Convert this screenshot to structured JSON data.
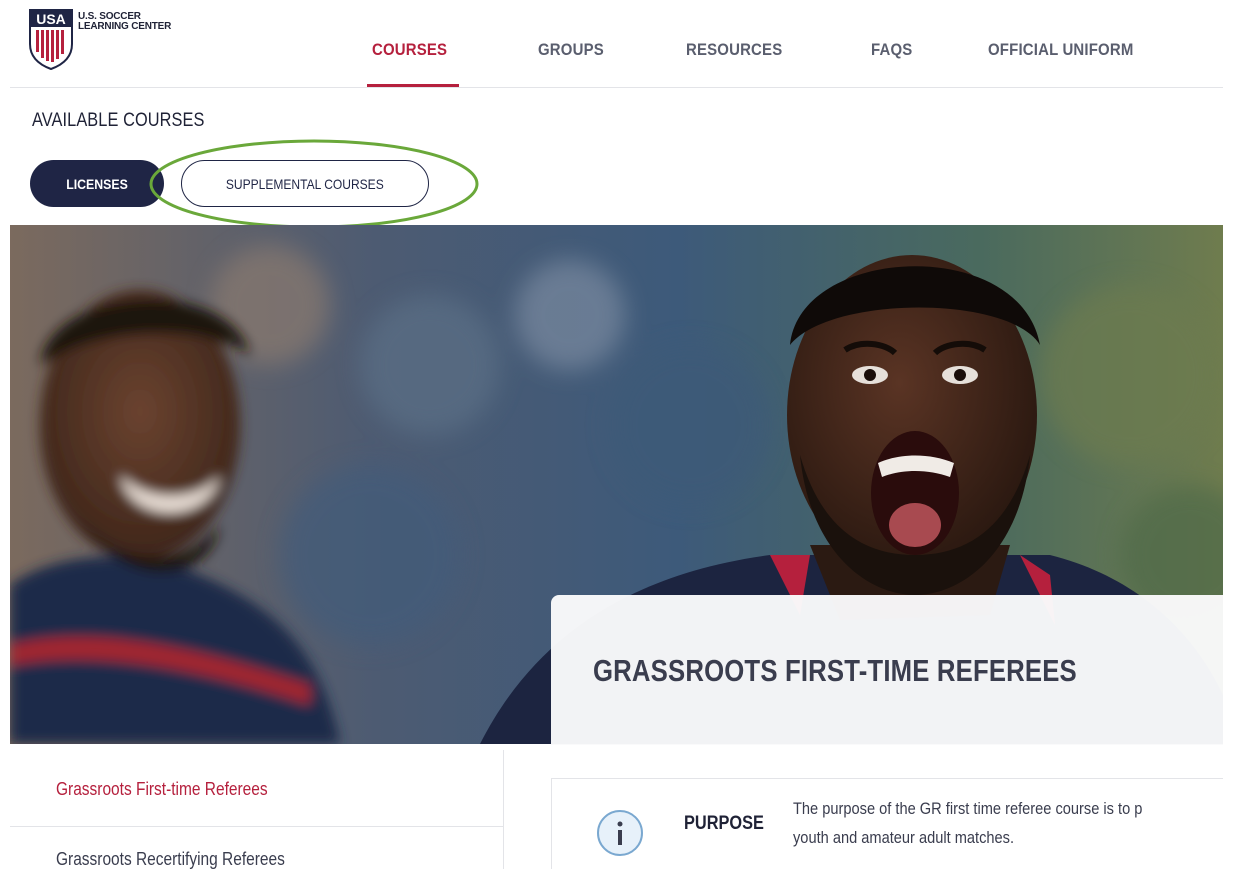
{
  "header": {
    "logo_line1": "U.S. SOCCER",
    "logo_line2": "LEARNING CENTER",
    "logo_mark": "USA",
    "nav": [
      {
        "label": "COURSES",
        "active": true
      },
      {
        "label": "GROUPS",
        "active": false
      },
      {
        "label": "RESOURCES",
        "active": false
      },
      {
        "label": "FAQS",
        "active": false
      },
      {
        "label": "OFFICIAL UNIFORM",
        "active": false
      }
    ]
  },
  "main": {
    "section_title": "AVAILABLE COURSES",
    "toggle": {
      "licenses_label": "LICENSES",
      "supplemental_label": "SUPPLEMENTAL COURSES"
    },
    "hero": {
      "card_title": "GRASSROOTS FIRST-TIME REFEREES"
    },
    "course_list": [
      {
        "label": "Grassroots First-time Referees",
        "active": true
      },
      {
        "label": "Grassroots Recertifying Referees",
        "active": false
      }
    ],
    "detail": {
      "icon": "info-icon",
      "purpose_label": "PURPOSE",
      "purpose_line1": "The purpose of the GR first time referee course is to p",
      "purpose_line2": "youth and amateur adult matches."
    }
  },
  "colors": {
    "accent": "#b5203d",
    "navy": "#1f2545",
    "highlight": "#6aa83a"
  }
}
